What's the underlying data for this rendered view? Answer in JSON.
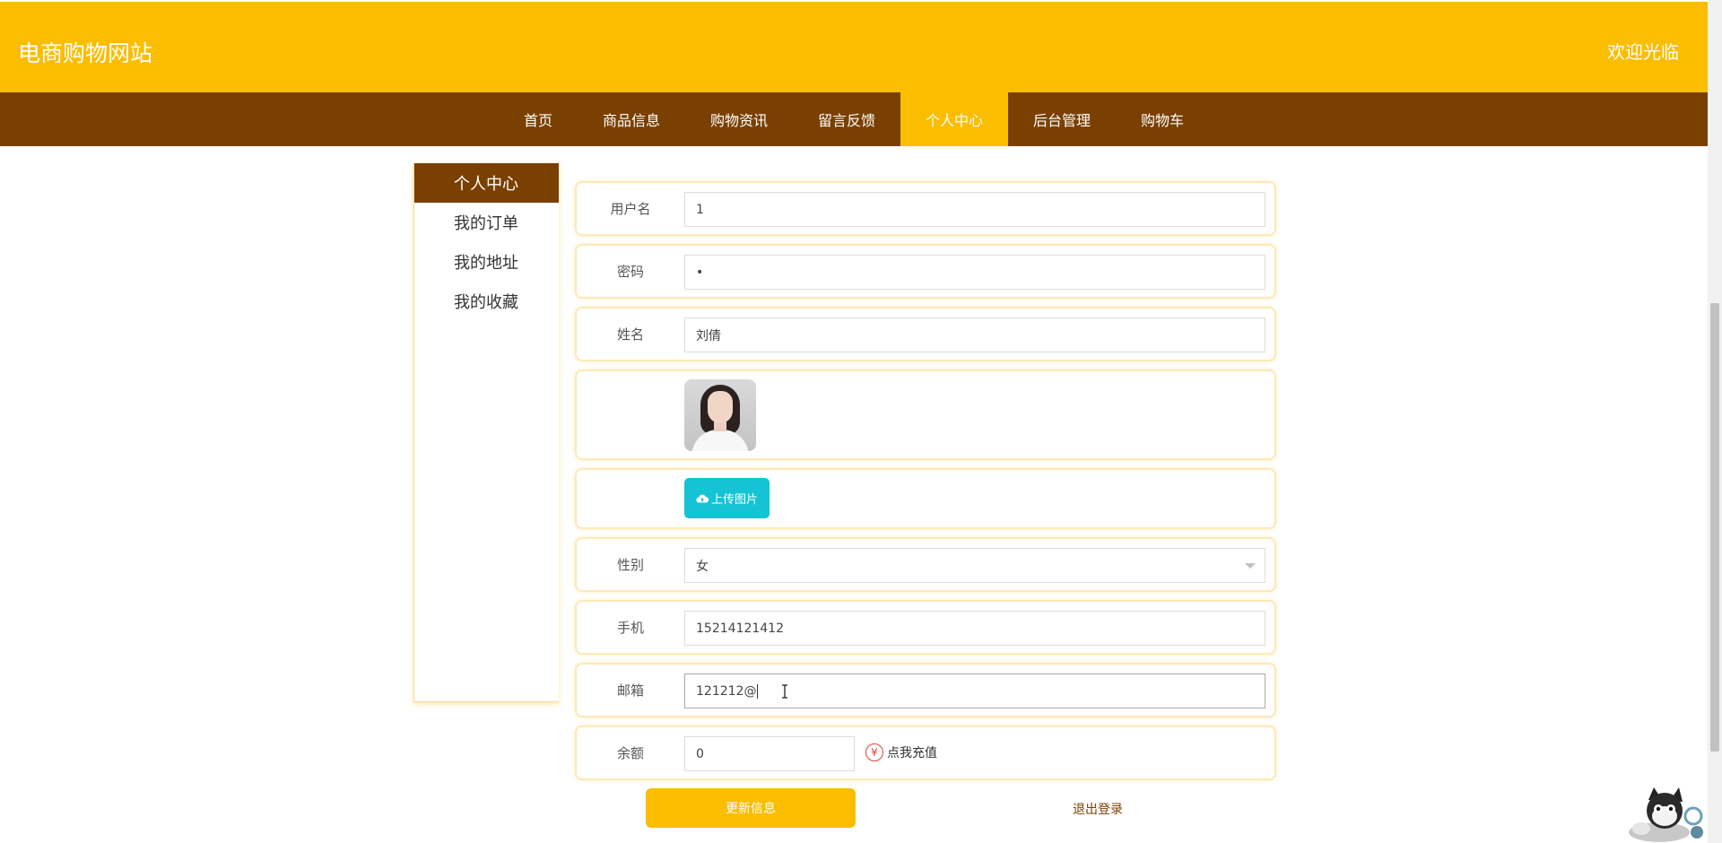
{
  "header": {
    "site_title": "电商购物网站",
    "welcome": "欢迎光临"
  },
  "nav": {
    "items": [
      {
        "label": "首页"
      },
      {
        "label": "商品信息"
      },
      {
        "label": "购物资讯"
      },
      {
        "label": "留言反馈"
      },
      {
        "label": "个人中心",
        "active": true
      },
      {
        "label": "后台管理"
      },
      {
        "label": "购物车"
      }
    ]
  },
  "sidebar": {
    "title": "个人中心",
    "items": [
      {
        "label": "我的订单"
      },
      {
        "label": "我的地址"
      },
      {
        "label": "我的收藏"
      }
    ]
  },
  "form": {
    "username": {
      "label": "用户名",
      "value": "1"
    },
    "password": {
      "label": "密码",
      "value": "•"
    },
    "name": {
      "label": "姓名",
      "value": "刘倩"
    },
    "upload": {
      "label": "上传图片",
      "icon": "cloud-upload-icon"
    },
    "gender": {
      "label": "性别",
      "value": "女"
    },
    "phone": {
      "label": "手机",
      "value": "15214121412"
    },
    "email": {
      "label": "邮箱",
      "value": "121212@"
    },
    "balance": {
      "label": "余额",
      "value": "0",
      "recharge_label": "点我充值",
      "recharge_symbol": "¥"
    }
  },
  "actions": {
    "update_label": "更新信息",
    "logout_label": "退出登录"
  },
  "colors": {
    "primary": "#fbbd00",
    "nav_bg": "#7a4001",
    "upload_button": "#14c4d4",
    "recharge_icon": "#e0403a"
  }
}
